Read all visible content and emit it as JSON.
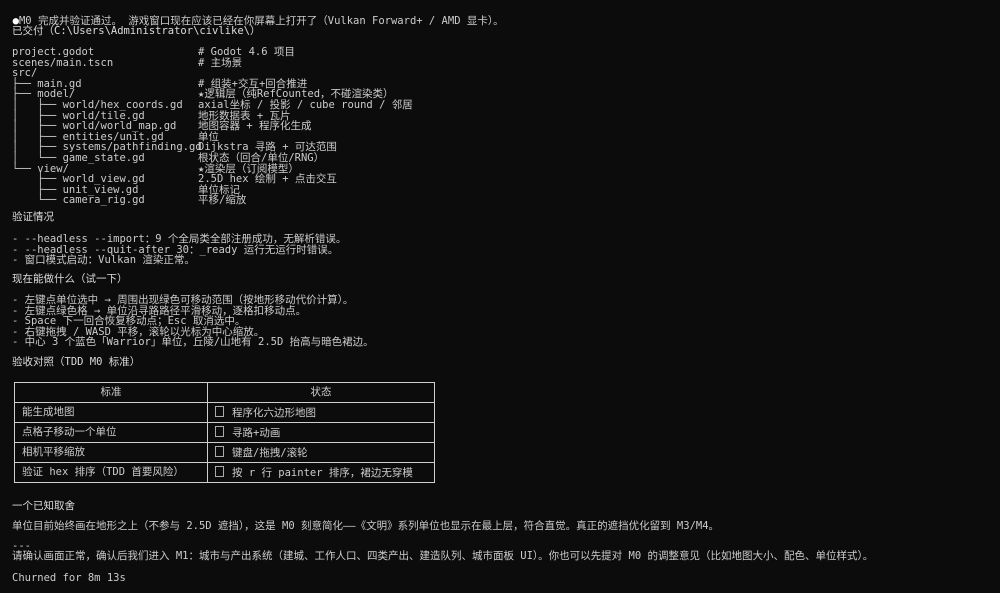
{
  "top_line": {
    "bullet": "●",
    "text": "M0 完成并验证通过。 游戏窗口现在应该已经在你屏幕上打开了（Vulkan Forward+ / AMD 显卡）。"
  },
  "delivered": {
    "heading": "已交付（C:\\Users\\Administrator\\civlike\\）",
    "tree": [
      {
        "path": "project.godot",
        "desc": "# Godot 4.6 项目"
      },
      {
        "path": "scenes/main.tscn",
        "desc": "# 主场景"
      },
      {
        "path": "src/",
        "desc": ""
      },
      {
        "path": "├── main.gd",
        "desc": "# 组装+交互+回合推进"
      },
      {
        "path": "├── model/",
        "desc": "★逻辑层（纯RefCounted，不碰渲染类）"
      },
      {
        "path": "│   ├── world/hex_coords.gd",
        "desc": "axial坐标 / 投影 / cube round / 邻居"
      },
      {
        "path": "│   ├── world/tile.gd",
        "desc": "地形数据表 + 瓦片"
      },
      {
        "path": "│   ├── world/world_map.gd",
        "desc": "地图容器 + 程序化生成"
      },
      {
        "path": "│   ├── entities/unit.gd",
        "desc": "单位"
      },
      {
        "path": "│   ├── systems/pathfinding.gd",
        "desc": "Dijkstra 寻路 + 可达范围"
      },
      {
        "path": "│   └── game_state.gd",
        "desc": "根状态（回合/单位/RNG）"
      },
      {
        "path": "└── view/",
        "desc": "★渲染层（订阅模型）"
      },
      {
        "path": "    ├── world_view.gd",
        "desc": "2.5D hex 绘制 + 点击交互"
      },
      {
        "path": "    ├── unit_view.gd",
        "desc": "单位标记"
      },
      {
        "path": "    └── camera_rig.gd",
        "desc": "平移/缩放"
      }
    ]
  },
  "verification": {
    "heading": "验证情况",
    "lines": [
      "- --headless --import：9 个全局类全部注册成功，无解析错误。",
      "- --headless --quit-after 30：_ready 运行无运行时错误。",
      "- 窗口模式启动：Vulkan 渲染正常。"
    ]
  },
  "try_it": {
    "heading": "现在能做什么（试一下）",
    "lines": [
      "- 左键点单位选中 → 周围出现绿色可移动范围（按地形移动代价计算）。",
      "- 左键点绿色格 → 单位沿寻路路径平滑移动，逐格扣移动点。",
      "- Space 下一回合恢复移动点；Esc 取消选中。",
      "- 右键拖拽 / WASD 平移，滚轮以光标为中心缩放。",
      "- 中心 3 个蓝色「Warrior」单位，丘陵/山地有 2.5D 抬高与暗色裙边。"
    ]
  },
  "acceptance": {
    "heading": "验收对照（TDD M0 标准）",
    "columns": [
      "标准",
      "状态"
    ],
    "rows": [
      {
        "criterion": "能生成地图",
        "status": "程序化六边形地图"
      },
      {
        "criterion": "点格子移动一个单位",
        "status": "寻路+动画"
      },
      {
        "criterion": "相机平移缩放",
        "status": "键盘/拖拽/滚轮"
      },
      {
        "criterion": "验证 hex 排序（TDD 首要风险）",
        "status": "按 r 行 painter 排序，裙边无穿模"
      }
    ]
  },
  "known_tradeoff": {
    "heading": "一个已知取舍",
    "text": "单位目前始终画在地形之上（不参与 2.5D 遮挡），这是 M0 刻意简化——《文明》系列单位也显示在最上层，符合直觉。真正的遮挡优化留到 M3/M4。"
  },
  "footer": {
    "separator": "---",
    "prompt": "请确认画面正常，确认后我们进入 M1：城市与产出系统（建城、工作人口、四类产出、建造队列、城市面板 UI）。你也可以先提对 M0 的调整意见（比如地图大小、配色、单位样式）。",
    "status": "Churned for 8m 13s"
  },
  "colors": {
    "background": "#0c0c0c",
    "text": "#cccccc",
    "border": "#cfcfcf"
  }
}
